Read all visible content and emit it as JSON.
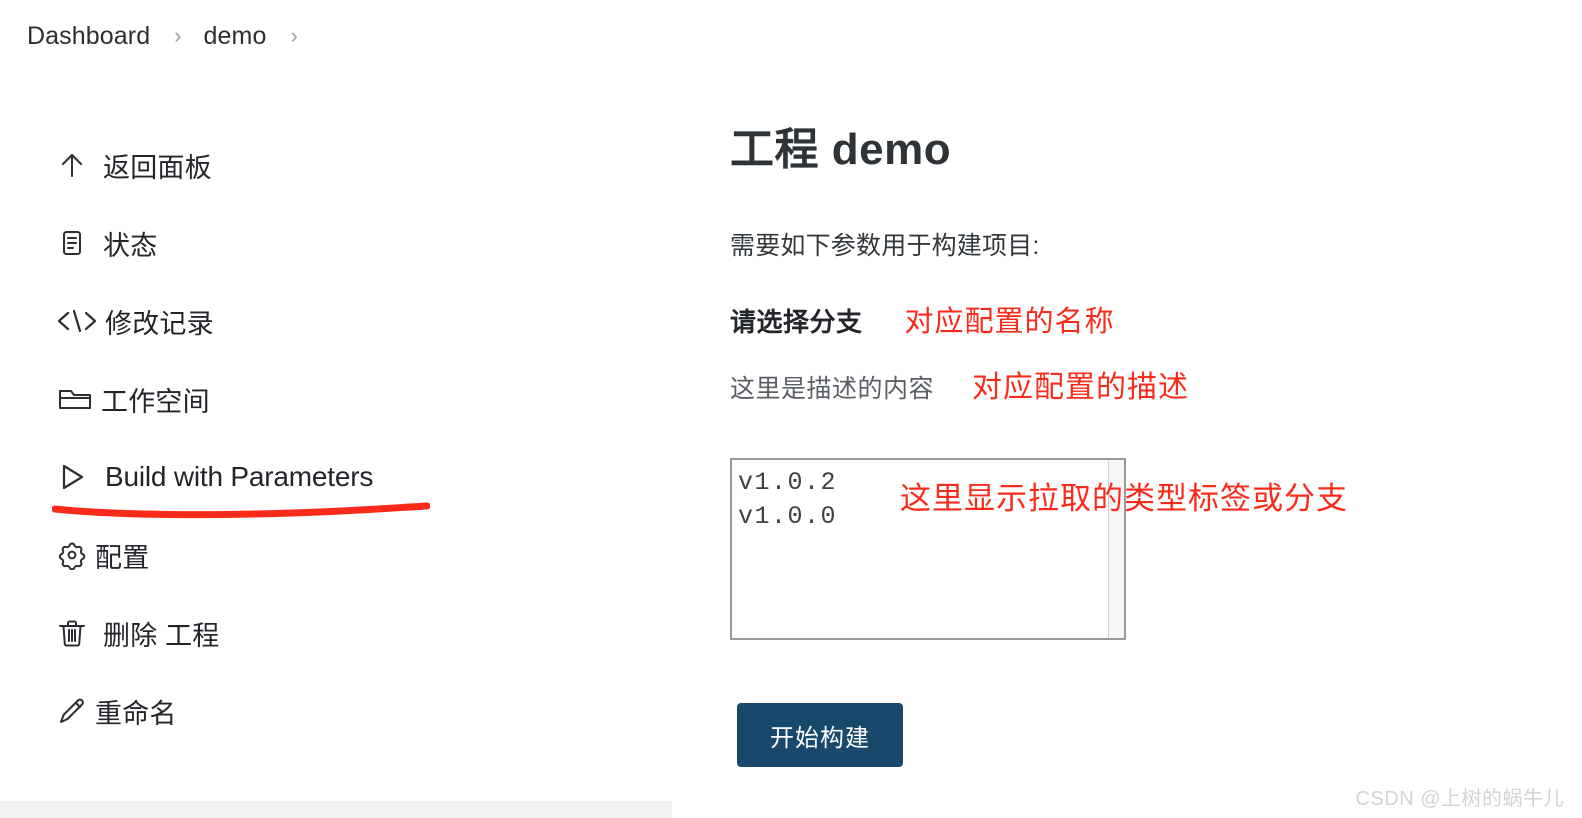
{
  "breadcrumb": {
    "items": [
      {
        "label": "Dashboard"
      },
      {
        "label": "demo"
      }
    ],
    "separator": "›"
  },
  "sidebar": {
    "items": [
      {
        "icon": "arrow-up-icon",
        "label": "返回面板"
      },
      {
        "icon": "document-icon",
        "label": "状态"
      },
      {
        "icon": "code-icon",
        "label": "修改记录"
      },
      {
        "icon": "folder-icon",
        "label": "工作空间"
      },
      {
        "icon": "play-icon",
        "label": "Build with Parameters"
      },
      {
        "icon": "gear-icon",
        "label": "配置"
      },
      {
        "icon": "trash-icon",
        "label": "删除 工程"
      },
      {
        "icon": "pencil-icon",
        "label": "重命名"
      }
    ],
    "highlighted_item": "Build with Parameters",
    "highlight_color": "#fb2b1c"
  },
  "main": {
    "title": "工程 demo",
    "intro": "需要如下参数用于构建项目:",
    "parameter": {
      "name": "请选择分支",
      "description": "这里是描述的内容",
      "options": [
        "v1.0.2",
        "v1.0.0"
      ]
    },
    "build_button_label": "开始构建",
    "build_button_color": "#18486b"
  },
  "annotations": {
    "color": "#fb2b1c",
    "name_note": "对应配置的名称",
    "desc_note": "对应配置的描述",
    "list_note": "这里显示拉取的类型标签或分支"
  },
  "watermark": "CSDN @上树的蜗牛儿"
}
